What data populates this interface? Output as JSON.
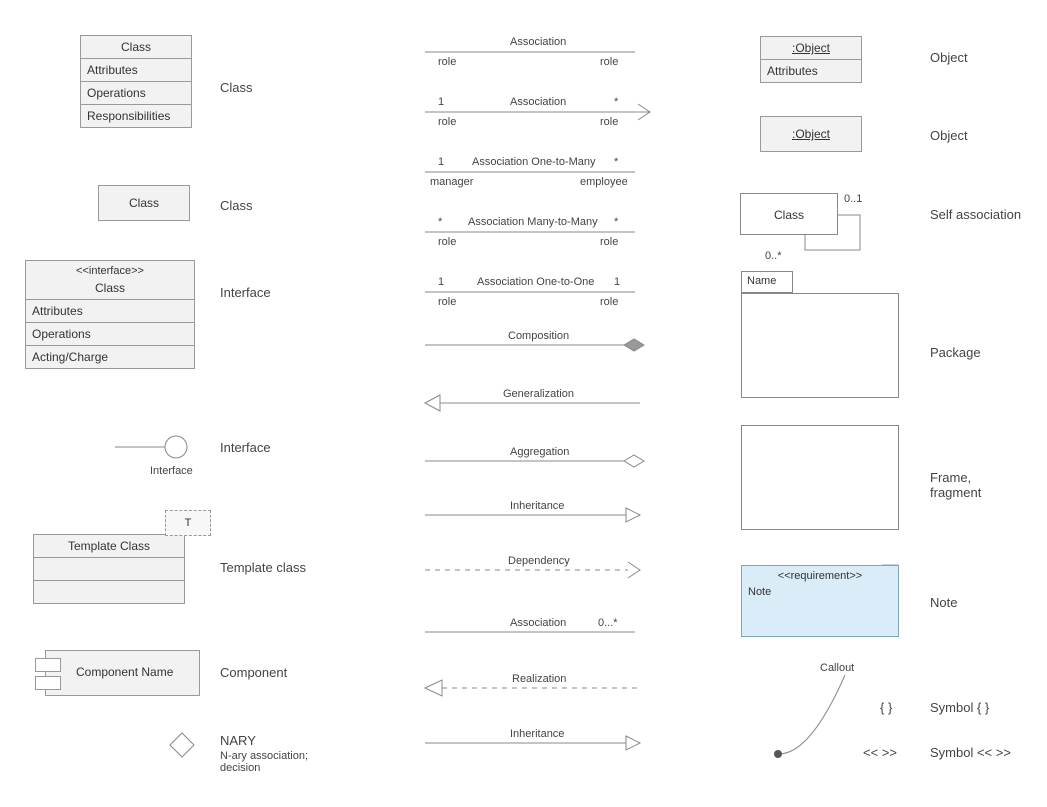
{
  "col1": {
    "classFull": {
      "title": "Class",
      "r1": "Attributes",
      "r2": "Operations",
      "r3": "Responsibilities"
    },
    "classSimple": {
      "title": "Class"
    },
    "interfaceClass": {
      "stereo": "<<interface>>",
      "title": "Class",
      "r1": "Attributes",
      "r2": "Operations",
      "r3": "Acting/Charge"
    },
    "ifaceLollipop": "Interface",
    "templateClass": {
      "title": "Template Class",
      "param": "T"
    },
    "component": {
      "title": "Component Name"
    }
  },
  "labels": {
    "class1": "Class",
    "class2": "Class",
    "interface1": "Interface",
    "interface2": "Interface",
    "template": "Template class",
    "component": "Component",
    "nary": "NARY",
    "narySub": "N-ary association; decision",
    "object1": "Object",
    "object2": "Object",
    "selfAssoc": "Self association",
    "package": "Package",
    "frame": "Frame, fragment",
    "note": "Note",
    "callout": "Callout",
    "symbolBraces": "Symbol { }",
    "symbolAngles": "Symbol << >>"
  },
  "lines": {
    "assoc1": {
      "label": "Association",
      "roleL": "role",
      "roleR": "role"
    },
    "assoc2": {
      "multL": "1",
      "label": "Association",
      "multR": "*",
      "roleL": "role",
      "roleR": "role"
    },
    "assoc3": {
      "multL": "1",
      "label": "Association One-to-Many",
      "multR": "*",
      "roleL": "manager",
      "roleR": "employee"
    },
    "assoc4": {
      "multL": "*",
      "label": "Association Many-to-Many",
      "multR": "*",
      "roleL": "role",
      "roleR": "role"
    },
    "assoc5": {
      "multL": "1",
      "label": "Association One-to-One",
      "multR": "1",
      "roleL": "role",
      "roleR": "role"
    },
    "composition": "Composition",
    "generalization": "Generalization",
    "aggregation": "Aggregation",
    "inheritance": "Inheritance",
    "dependency": "Dependency",
    "associationMult": {
      "label": "Association",
      "mult": "0...*"
    },
    "realization": "Realization",
    "inheritance2": "Inheritance"
  },
  "col3": {
    "obj1": {
      "title": ":Object",
      "row": "Attributes"
    },
    "obj2": {
      "title": ":Object"
    },
    "selfAssoc": {
      "title": "Class",
      "multTop": "0..1",
      "multBot": "0..*"
    },
    "package": {
      "tab": "Name"
    },
    "note": {
      "stereo": "<<requirement>>",
      "body": "Note"
    },
    "callout": "Callout",
    "braces": "{ }",
    "angles": "<< >>"
  }
}
